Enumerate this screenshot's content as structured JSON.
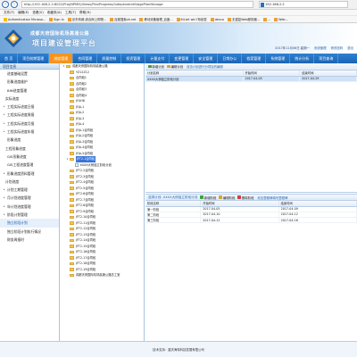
{
  "browser": {
    "url": "http://192.168.2.2:8022/Proj/NPMIS/Views/PlanProgress/IndependentStagePlanManage",
    "tab_title": "192.168.2.2",
    "menu": [
      "文件(F)",
      "编辑(E)",
      "查看(V)",
      "收藏夹(A)",
      "工具(T)",
      "帮助(H)"
    ],
    "favorites": [
      "Authentication Microso...",
      "Sign In",
      "京东商城-综合网上购物...",
      "百度搜索vb.net",
      "移动设备管理_百度...",
      "64-bit win7系统发",
      "devco",
      "无重复Web服务器...",
      "...",
      "Web..."
    ]
  },
  "header": {
    "subtitle": "成都天府国际机场高速公路",
    "title": "项目建设管理平台",
    "date_text": "2017年11月06日 星期一",
    "welcome": "系统管理",
    "link_change": "修改密码",
    "link_exit": "退出"
  },
  "nav": {
    "items": [
      "首 页",
      "项目前期管理",
      "进度管理",
      "合同管理",
      "质量控制",
      "投资管理",
      "计量支付",
      "变更管理",
      "安全管理",
      "日常办公",
      "档案管理",
      "系统管理",
      "统计分析",
      "项目查询"
    ],
    "active_index": 2
  },
  "sidebar": {
    "title": "项目信息",
    "items": [
      {
        "label": "进度基础设置",
        "type": "sub"
      },
      {
        "label": "形象进度维护",
        "type": "sub"
      },
      {
        "label": "BIM进度管理",
        "type": "sub"
      },
      {
        "label": "实际进度",
        "type": "group",
        "toggle": ""
      },
      {
        "label": "工程实际进度日报",
        "type": "sub",
        "toggle": "▸"
      },
      {
        "label": "工程实际进度周报",
        "type": "sub",
        "toggle": "▸"
      },
      {
        "label": "工程实际进度月报",
        "type": "sub",
        "toggle": "▸"
      },
      {
        "label": "工程实际进度年报",
        "type": "sub",
        "toggle": "▸"
      },
      {
        "label": "形象进度",
        "type": "sub"
      },
      {
        "label": "工程形象进度",
        "type": "group",
        "toggle": ""
      },
      {
        "label": "GIS形象进度",
        "type": "sub"
      },
      {
        "label": "GIS工程进度管理",
        "type": "sub"
      },
      {
        "label": "形象进度资料管理",
        "type": "sub",
        "toggle": "▸"
      },
      {
        "label": "计划进度",
        "type": "group",
        "toggle": ""
      },
      {
        "label": "计划工期管理",
        "type": "sub",
        "toggle": "▸"
      },
      {
        "label": "月计划进度管理",
        "type": "sub",
        "toggle": "▸"
      },
      {
        "label": "年计划进度管理",
        "type": "sub",
        "toggle": "▸"
      },
      {
        "label": "阶段计划管理",
        "type": "sub",
        "toggle": "▸"
      },
      {
        "label": "独立阶段计划",
        "type": "sub",
        "active": true
      },
      {
        "label": "独立阶段计划执行情况",
        "type": "sub"
      },
      {
        "label": "财务周报时",
        "type": "sub"
      }
    ]
  },
  "tree": {
    "root": "成都天府国际机场高速公路",
    "nodes": [
      {
        "label": "YZ12Z12",
        "indent": 2
      },
      {
        "label": "合同段1",
        "indent": 2
      },
      {
        "label": "合同段2",
        "indent": 2
      },
      {
        "label": "合同段3",
        "indent": 2
      },
      {
        "label": "合同段4",
        "indent": 2
      },
      {
        "label": "JFXHB",
        "indent": 2
      },
      {
        "label": "JFJA-1",
        "indent": 2
      },
      {
        "label": "JFJA-2",
        "indent": 2
      },
      {
        "label": "JFJA-3",
        "indent": 2
      },
      {
        "label": "JFJA-4",
        "indent": 2
      },
      {
        "label": "JFJA-1合同段",
        "indent": 2
      },
      {
        "label": "JFJA-2合同段",
        "indent": 2
      },
      {
        "label": "JFJA-3合同段",
        "indent": 2
      },
      {
        "label": "JFJA-4合同段",
        "indent": 2
      },
      {
        "label": "JFJA-5合同段",
        "indent": 2
      },
      {
        "label": "JFT2-1合同段",
        "indent": 2,
        "selected": true,
        "toggle": "▾"
      },
      {
        "label": "XXXX大桥独立阶段计划",
        "indent": 4,
        "file": true
      },
      {
        "label": "JFT2-2合同段",
        "indent": 2
      },
      {
        "label": "JFT2-3合同段",
        "indent": 2
      },
      {
        "label": "JFT2-4合同段",
        "indent": 2
      },
      {
        "label": "JFT2-5合同段",
        "indent": 2
      },
      {
        "label": "JFT2-6合同段",
        "indent": 2
      },
      {
        "label": "JFT2-7合同段",
        "indent": 2
      },
      {
        "label": "JFT2-8合同段",
        "indent": 2
      },
      {
        "label": "JFT2-9合同段",
        "indent": 2
      },
      {
        "label": "JFT2-10合同段",
        "indent": 2
      },
      {
        "label": "JFT2-11合同段",
        "indent": 2
      },
      {
        "label": "JFT2-12合同段",
        "indent": 2
      },
      {
        "label": "JFT2-13合同段",
        "indent": 2
      },
      {
        "label": "JFT2-14合同段",
        "indent": 2
      },
      {
        "label": "JFT2-15合同段",
        "indent": 2
      },
      {
        "label": "JFT2-16合同段",
        "indent": 2
      },
      {
        "label": "JFT2-17合同段",
        "indent": 2
      },
      {
        "label": "JFT2-18合同段",
        "indent": 2
      },
      {
        "label": "JFT2-19合同段",
        "indent": 2
      },
      {
        "label": "成都天府国际机场高速公路总工室",
        "indent": 2
      }
    ]
  },
  "top_grid": {
    "toolbar": {
      "add": "新增计划",
      "edit": "编辑计划",
      "hint": "双击计划进行分项目的编辑"
    },
    "columns": [
      "计划名称",
      "开始时间",
      "结束时间"
    ],
    "rows": [
      [
        "XXXX大桥独立阶段计划",
        "2017-04-05",
        "2017-04-29"
      ]
    ]
  },
  "bottom_grid": {
    "title": "选择计划: XXXX大桥独立阶段计划",
    "toolbar": {
      "add": "新增阶段",
      "edit": "编辑阶段",
      "delete": "删除阶段",
      "hint": "双击里程碑填写里程碑"
    },
    "columns": [
      "阶段名称",
      "开始时间",
      "结束时间"
    ],
    "rows": [
      [
        "第一阶段",
        "2017-04-05",
        "2017-04-09"
      ],
      [
        "第二阶段",
        "2017-04-10",
        "2017-04-12"
      ],
      [
        "第三阶段",
        "2017-04-12",
        "2017-04-16"
      ]
    ]
  },
  "footer": {
    "text": "技术支持：重庆海特科技发展有限公司"
  },
  "colors": {
    "nav_bg": "#1f6cbf",
    "nav_active": "#f7941d",
    "accent_link": "#2a68b0"
  }
}
